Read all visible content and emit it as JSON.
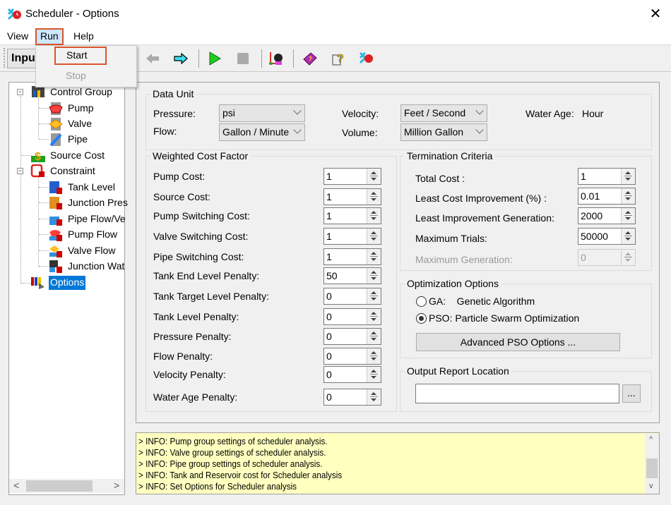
{
  "window": {
    "title": "Scheduler - Options",
    "close_label": "✕"
  },
  "menu": {
    "items": [
      {
        "label": "View"
      },
      {
        "label": "Run"
      },
      {
        "label": "Help"
      }
    ],
    "run_dropdown": [
      {
        "label": "Start",
        "enabled": true
      },
      {
        "label": "Stop",
        "enabled": false
      }
    ]
  },
  "toolbar": {
    "combo_value": "Input",
    "icons": [
      "arrow-left-icon",
      "arrow-right-icon",
      "play-icon",
      "stop-icon",
      "tools-icon",
      "help-book-icon",
      "help-context-icon",
      "scheduler-icon"
    ]
  },
  "tree": {
    "items": [
      {
        "label": "Control Group",
        "level": 0,
        "expanded": true
      },
      {
        "label": "Pump",
        "level": 1
      },
      {
        "label": "Valve",
        "level": 1
      },
      {
        "label": "Pipe",
        "level": 1
      },
      {
        "label": "Source Cost",
        "level": 0
      },
      {
        "label": "Constraint",
        "level": 0,
        "expanded": true
      },
      {
        "label": "Tank Level",
        "level": 1
      },
      {
        "label": "Junction Pres",
        "level": 1
      },
      {
        "label": "Pipe Flow/Ve",
        "level": 1
      },
      {
        "label": "Pump Flow",
        "level": 1
      },
      {
        "label": "Valve Flow",
        "level": 1
      },
      {
        "label": "Junction Wat",
        "level": 1
      },
      {
        "label": "Options",
        "level": 0,
        "selected": true
      }
    ],
    "scroll_left": "<",
    "scroll_right": ">"
  },
  "data_unit": {
    "title": "Data Unit",
    "pressure_label": "Pressure:",
    "pressure_value": "psi",
    "flow_label": "Flow:",
    "flow_value": "Gallon / Minute",
    "velocity_label": "Velocity:",
    "velocity_value": "Feet / Second",
    "volume_label": "Volume:",
    "volume_value": "Million Gallon",
    "water_age_label": "Water Age:",
    "water_age_value": "Hour"
  },
  "weighted_cost": {
    "title": "Weighted Cost Factor",
    "rows": [
      {
        "label": "Pump Cost:",
        "value": "1"
      },
      {
        "label": "Source Cost:",
        "value": "1"
      },
      {
        "label": "Pump Switching Cost:",
        "value": "1"
      },
      {
        "label": "Valve Switching Cost:",
        "value": "1"
      },
      {
        "label": "Pipe Switching Cost:",
        "value": "1"
      },
      {
        "label": "Tank End Level Penalty:",
        "value": "50"
      },
      {
        "label": "Tank Target Level Penalty:",
        "value": "0"
      },
      {
        "label": "Tank Level Penalty:",
        "value": "0"
      },
      {
        "label": "Pressure Penalty:",
        "value": "0"
      },
      {
        "label": "Flow Penalty:",
        "value": "0"
      },
      {
        "label": "Velocity Penalty:",
        "value": "0"
      },
      {
        "label": "Water Age Penalty:",
        "value": "0"
      }
    ]
  },
  "termination": {
    "title": "Termination Criteria",
    "rows": [
      {
        "label": "Total Cost :",
        "value": "1",
        "enabled": true
      },
      {
        "label": "Least Cost Improvement (%) :",
        "value": "0.01",
        "enabled": true
      },
      {
        "label": "Least Improvement Generation:",
        "value": "2000",
        "enabled": true
      },
      {
        "label": "Maximum Trials:",
        "value": "50000",
        "enabled": true
      },
      {
        "label": "Maximum Generation:",
        "value": "0",
        "enabled": false
      }
    ]
  },
  "optimization": {
    "title": "Optimization Options",
    "ga_label": "GA:    Genetic Algorithm",
    "pso_label": "PSO: Particle Swarm Optimization",
    "selected": "PSO",
    "advanced_button": "Advanced PSO Options ..."
  },
  "output": {
    "title": "Output Report Location",
    "path_value": "",
    "browse_label": "..."
  },
  "log": {
    "lines": [
      "> INFO: Pump group settings of scheduler analysis.",
      "> INFO: Valve group settings of scheduler analysis.",
      "> INFO: Pipe group settings of scheduler analysis.",
      "> INFO: Tank and Reservoir cost for Scheduler analysis",
      "> INFO: Set Options for Scheduler analysis"
    ],
    "scroll_up": "^",
    "scroll_down": "v"
  }
}
